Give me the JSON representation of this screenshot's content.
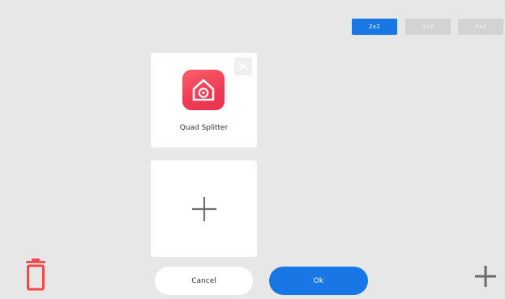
{
  "layout_tabs": [
    {
      "label": "2x2",
      "selected": true
    },
    {
      "label": "3x2",
      "selected": false
    },
    {
      "label": "4x2",
      "selected": false
    }
  ],
  "app_card": {
    "app_name": "Quad Splitter",
    "icon": "house-camera-icon",
    "close_icon": "close-icon"
  },
  "add_card": {
    "icon": "plus-icon"
  },
  "footer": {
    "delete_icon": "trash-icon",
    "cancel_label": "Cancel",
    "ok_label": "Ok",
    "add_icon": "plus-icon"
  },
  "colors": {
    "accent": "#1877e4",
    "danger": "#ef4a4a",
    "app_icon": "#ee3d57"
  }
}
